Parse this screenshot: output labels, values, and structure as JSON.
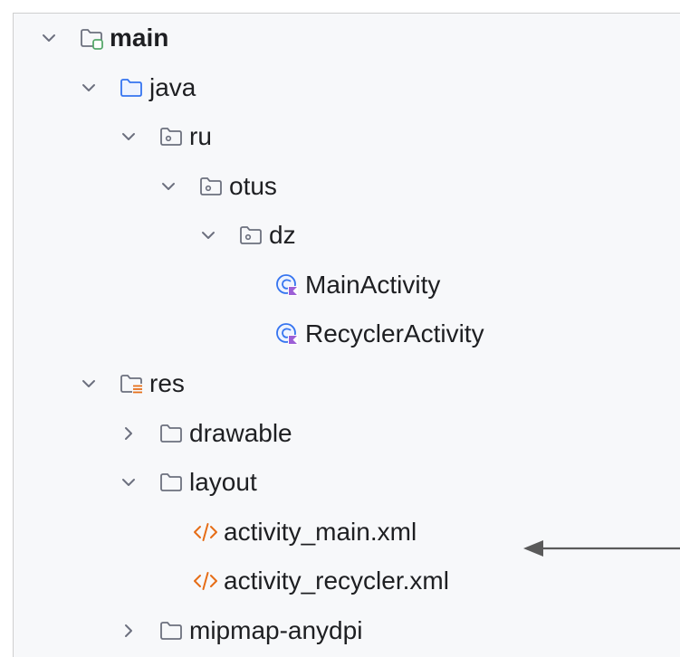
{
  "tree": {
    "items": [
      {
        "label": "main",
        "icon": "module-folder-icon",
        "expanded": true,
        "bold": true
      },
      {
        "label": "java",
        "icon": "source-folder-icon",
        "expanded": true
      },
      {
        "label": "ru",
        "icon": "package-icon",
        "expanded": true
      },
      {
        "label": "otus",
        "icon": "package-icon",
        "expanded": true
      },
      {
        "label": "dz",
        "icon": "package-icon",
        "expanded": true
      },
      {
        "label": "MainActivity",
        "icon": "kotlin-class-icon"
      },
      {
        "label": "RecyclerActivity",
        "icon": "kotlin-class-icon"
      },
      {
        "label": "res",
        "icon": "resource-folder-icon",
        "expanded": true
      },
      {
        "label": "drawable",
        "icon": "folder-icon",
        "expanded": false
      },
      {
        "label": "layout",
        "icon": "folder-icon",
        "expanded": true
      },
      {
        "label": "activity_main.xml",
        "icon": "xml-file-icon"
      },
      {
        "label": "activity_recycler.xml",
        "icon": "xml-file-icon"
      },
      {
        "label": "mipmap-anydpi",
        "icon": "folder-icon",
        "expanded": false
      }
    ]
  },
  "annotation": {
    "icon": "arrow-left-icon",
    "points_to": "activity_main.xml"
  },
  "colors": {
    "panel_bg": "#f7f8fa",
    "text": "#1e1f22",
    "chevron": "#6c707e",
    "folder_stroke": "#6c707e",
    "source_folder": "#3574f0",
    "module_badge": "#55a76a",
    "resource_lines": "#e66d17",
    "xml_icon": "#e66d17",
    "kotlin_class": "#3574f0",
    "kotlin_badge": "#9c5fd6",
    "arrow": "#5a5a5a"
  }
}
